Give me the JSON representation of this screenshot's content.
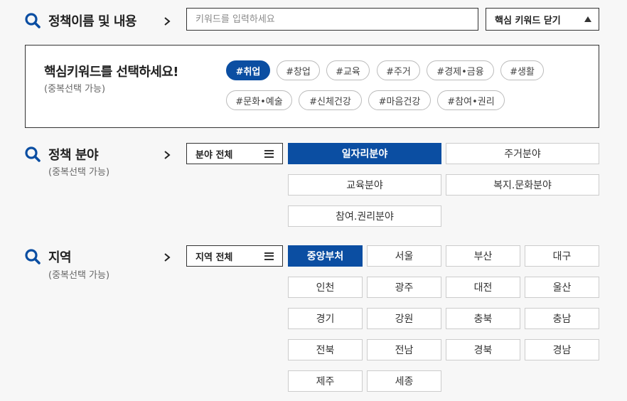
{
  "policy_name": {
    "title": "정책이름 및 내용",
    "search_placeholder": "키워드를 입력하세요",
    "close_keyword_label": "핵심 키워드 닫기"
  },
  "keywords": {
    "title": "핵심키워드를 선택하세요!",
    "subtitle": "(중복선택 가능)",
    "chips": [
      {
        "label": "#취업",
        "active": true
      },
      {
        "label": "#창업",
        "active": false
      },
      {
        "label": "#교육",
        "active": false
      },
      {
        "label": "#주거",
        "active": false
      },
      {
        "label": "#경제•금융",
        "active": false
      },
      {
        "label": "#생활",
        "active": false
      },
      {
        "label": "#문화•예술",
        "active": false
      },
      {
        "label": "#신체건강",
        "active": false
      },
      {
        "label": "#마음건강",
        "active": false
      },
      {
        "label": "#참여•권리",
        "active": false
      }
    ]
  },
  "field": {
    "title": "정책 분야",
    "subtitle": "(중복선택 가능)",
    "all_label": "분야 전체",
    "options": [
      {
        "label": "일자리분야",
        "active": true
      },
      {
        "label": "주거분야",
        "active": false
      },
      {
        "label": "교육분야",
        "active": false
      },
      {
        "label": "복지.문화분야",
        "active": false
      },
      {
        "label": "참여.권리분야",
        "active": false
      }
    ]
  },
  "region": {
    "title": "지역",
    "subtitle": "(중복선택 가능)",
    "all_label": "지역 전체",
    "options": [
      {
        "label": "중앙부처",
        "active": true
      },
      {
        "label": "서울",
        "active": false
      },
      {
        "label": "부산",
        "active": false
      },
      {
        "label": "대구",
        "active": false
      },
      {
        "label": "인천",
        "active": false
      },
      {
        "label": "광주",
        "active": false
      },
      {
        "label": "대전",
        "active": false
      },
      {
        "label": "울산",
        "active": false
      },
      {
        "label": "경기",
        "active": false
      },
      {
        "label": "강원",
        "active": false
      },
      {
        "label": "충북",
        "active": false
      },
      {
        "label": "충남",
        "active": false
      },
      {
        "label": "전북",
        "active": false
      },
      {
        "label": "전남",
        "active": false
      },
      {
        "label": "경북",
        "active": false
      },
      {
        "label": "경남",
        "active": false
      },
      {
        "label": "제주",
        "active": false
      },
      {
        "label": "세종",
        "active": false
      }
    ]
  },
  "colors": {
    "accent": "#0b4ea2",
    "border": "#333333",
    "background": "#f7f7f7"
  }
}
